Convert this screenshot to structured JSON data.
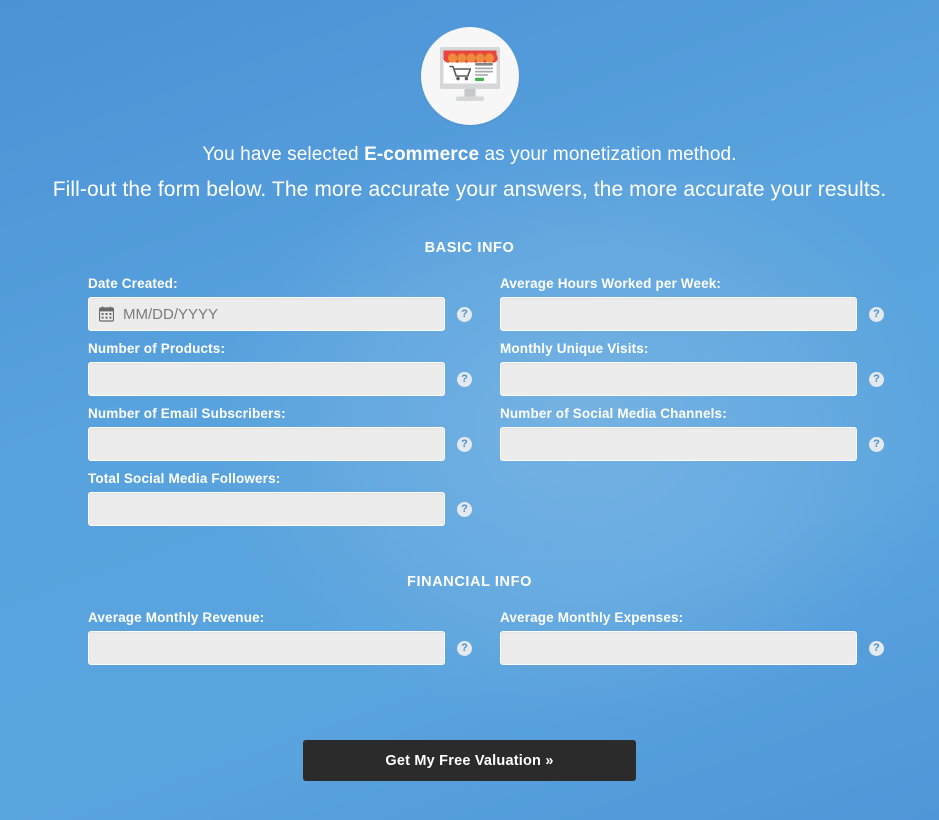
{
  "theme": {
    "background_blue": "#58a3de",
    "input_background": "#ececec",
    "button_background": "#2b2b2b",
    "text_white": "#ffffff",
    "help_icon_color": "#4a8fd0"
  },
  "hero": {
    "icon_name": "ecommerce-storefront-monitor-icon",
    "line_1_before": "You have selected ",
    "line_1_emphasis": "E-commerce",
    "line_1_after": " as your monetization method.",
    "line_2": "Fill-out the form below. The more accurate your answers, the more accurate your results."
  },
  "sections": [
    {
      "title": "BASIC INFO",
      "fields": [
        {
          "label": "Date Created:",
          "value": "",
          "placeholder": "MM/DD/YYYY",
          "icon": "calendar-icon",
          "help": "?"
        },
        {
          "label": "Average Hours Worked per Week:",
          "value": "",
          "placeholder": "",
          "icon": "",
          "help": "?"
        },
        {
          "label": "Number of Products:",
          "value": "",
          "placeholder": "",
          "icon": "",
          "help": "?"
        },
        {
          "label": "Monthly Unique Visits:",
          "value": "",
          "placeholder": "",
          "icon": "",
          "help": "?"
        },
        {
          "label": "Number of Email Subscribers:",
          "value": "",
          "placeholder": "",
          "icon": "",
          "help": "?"
        },
        {
          "label": "Number of Social Media Channels:",
          "value": "",
          "placeholder": "",
          "icon": "",
          "help": "?"
        },
        {
          "label": "Total Social Media Followers:",
          "value": "",
          "placeholder": "",
          "icon": "",
          "help": "?"
        }
      ]
    },
    {
      "title": "FINANCIAL INFO",
      "fields": [
        {
          "label": "Average Monthly Revenue:",
          "value": "",
          "placeholder": "",
          "icon": "",
          "help": "?"
        },
        {
          "label": "Average Monthly Expenses:",
          "value": "",
          "placeholder": "",
          "icon": "",
          "help": "?"
        }
      ]
    }
  ],
  "submit": {
    "label": "Get My Free Valuation »"
  }
}
